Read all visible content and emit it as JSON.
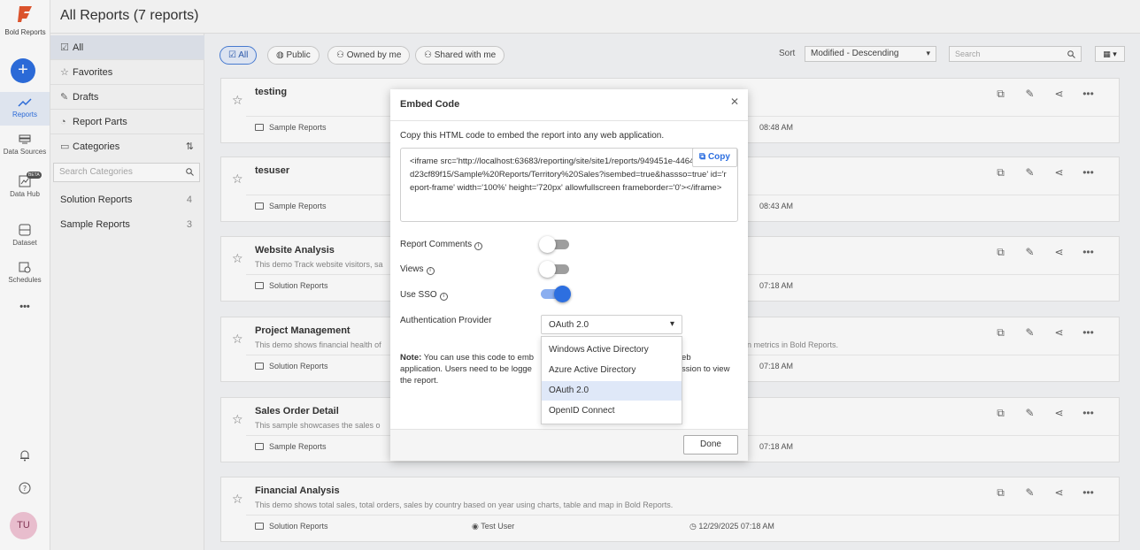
{
  "app": {
    "brand": "Bold Reports",
    "header_title": "All Reports (7 reports)"
  },
  "rail": {
    "items": [
      {
        "label": "Reports"
      },
      {
        "label": "Data Sources"
      },
      {
        "label": "Data Hub",
        "badge": "BETA"
      },
      {
        "label": "Dataset"
      },
      {
        "label": "Schedules"
      }
    ],
    "more": "•••",
    "avatar": "TU"
  },
  "panel": {
    "items": [
      {
        "label": "All"
      },
      {
        "label": "Favorites"
      },
      {
        "label": "Drafts"
      },
      {
        "label": "Report Parts"
      },
      {
        "label": "Categories"
      }
    ],
    "category_search_placeholder": "Search Categories",
    "categories": [
      {
        "name": "Solution Reports",
        "count": "4"
      },
      {
        "name": "Sample Reports",
        "count": "3"
      }
    ]
  },
  "filters": {
    "chips": [
      "All",
      "Public",
      "Owned by me",
      "Shared with me"
    ],
    "sort_label": "Sort",
    "sort_value": "Modified - Descending",
    "search_placeholder": "Search"
  },
  "reports": [
    {
      "title": "testing",
      "description": "",
      "category": "Sample Reports",
      "owner": "",
      "date": "08:48 AM"
    },
    {
      "title": "tesuser",
      "description": "",
      "category": "Sample Reports",
      "owner": "",
      "date": "08:43 AM"
    },
    {
      "title": "Website Analysis",
      "description": "This demo Track website visitors, sa",
      "category": "Solution Reports",
      "owner": "",
      "date": "07:18 AM"
    },
    {
      "title": "Project Management",
      "description": "This demo shows financial health of",
      "description_tail": "n metrics in Bold Reports.",
      "category": "Solution Reports",
      "owner": "",
      "date": "07:18 AM"
    },
    {
      "title": "Sales Order Detail",
      "description": "This sample showcases the sales o",
      "category": "Sample Reports",
      "owner": "",
      "date": "07:18 AM"
    },
    {
      "title": "Financial Analysis",
      "description": "This demo shows total sales, total orders, sales by country based on year using charts, table and map in Bold Reports.",
      "category": "Solution Reports",
      "owner": "Test User",
      "date": "12/29/2025 07:18 AM"
    }
  ],
  "modal": {
    "title": "Embed Code",
    "intro": "Copy this HTML code to embed the report into any web application.",
    "code": "<iframe src='http://localhost:63683/reporting/site/site1/reports/949451e-4464-b0e3-e0d23cf89f15/Sample%20Reports/Territory%20Sales?isembed=true&hassso=true' id='report-frame' width='100%' height='720px' allowfullscreen frameborder='0'></iframe>",
    "copy_label": "Copy",
    "options": [
      {
        "label": "Report Comments",
        "enabled": false
      },
      {
        "label": "Views",
        "enabled": false
      },
      {
        "label": "Use SSO",
        "enabled": true
      }
    ],
    "auth_label": "Authentication Provider",
    "auth_value": "OAuth 2.0",
    "auth_options": [
      "Windows Active Directory",
      "Azure Active Directory",
      "OAuth 2.0",
      "OpenID Connect"
    ],
    "note_label": "Note:",
    "note_text_1": "You can use this code to emb",
    "note_text_2": "eb",
    "note_line2_a": "application. Users need to be logge",
    "note_line2_b": "ission to view",
    "note_line3": "the report.",
    "done_label": "Done"
  }
}
